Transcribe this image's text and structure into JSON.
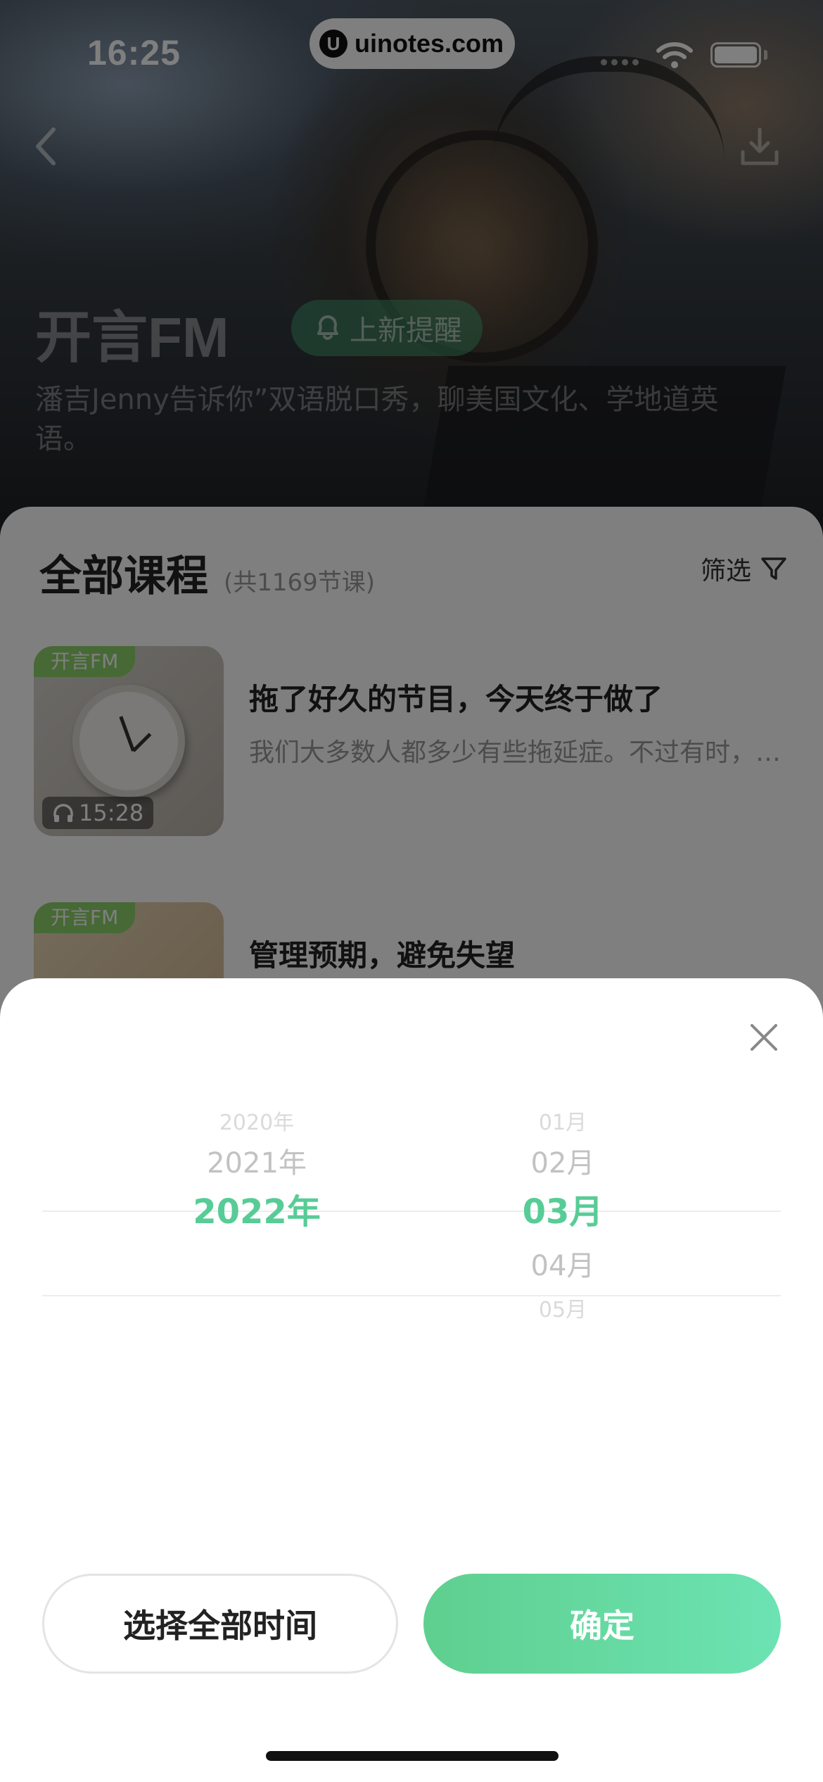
{
  "status_bar": {
    "time": "16:25",
    "url": "uinotes.com",
    "url_logo": "U",
    "icons": [
      "signal-icon",
      "wifi-icon",
      "battery-icon"
    ]
  },
  "hero": {
    "title": "开言FM",
    "remind_button": "上新提醒",
    "description": "潘吉Jenny告诉你”双语脱口秀，聊美国文化、学地道英语。"
  },
  "course_list": {
    "title": "全部课程",
    "count": "(共1169节课)",
    "filter_label": "筛选",
    "items": [
      {
        "tag": "开言FM",
        "duration": "15:28",
        "title": "拖了好久的节目，今天终于做了",
        "desc": "我们大多数人都多少有些拖延症。不过有时，…"
      },
      {
        "tag": "开言FM",
        "title": "管理预期，避免失望"
      }
    ]
  },
  "date_picker": {
    "years": [
      "2020年",
      "2021年",
      "2022年"
    ],
    "selected_year": "2022年",
    "months": [
      "01月",
      "02月",
      "03月",
      "04月",
      "05月"
    ],
    "selected_month": "03月",
    "accent_color": "#58cc96"
  },
  "actions": {
    "select_all_label": "选择全部时间",
    "confirm_label": "确定"
  }
}
